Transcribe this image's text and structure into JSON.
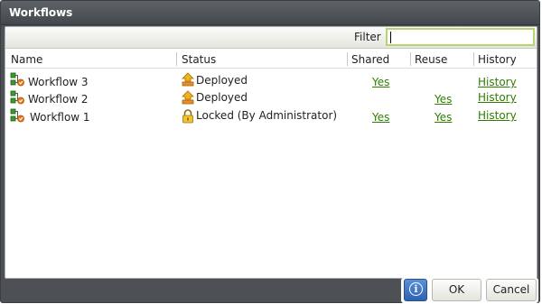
{
  "window": {
    "title": "Workflows"
  },
  "filter": {
    "label": "Filter",
    "value": "",
    "placeholder": ""
  },
  "columns": {
    "name": "Name",
    "status": "Status",
    "shared": "Shared",
    "reuse": "Reuse",
    "history": "History"
  },
  "rows": [
    {
      "name": "Workflow 3",
      "status": "Deployed",
      "status_icon": "deployed-icon",
      "shared": "Yes",
      "reuse": "",
      "history": "History"
    },
    {
      "name": "Workflow  2",
      "status": "Deployed",
      "status_icon": "deployed-icon",
      "shared": "",
      "reuse": "Yes",
      "history": "History"
    },
    {
      "name": "Workflow 1",
      "status": "Locked (By Administrator)",
      "status_icon": "lock-icon",
      "shared": "Yes",
      "reuse": "Yes",
      "history": "History"
    }
  ],
  "buttons": {
    "info": "i",
    "ok": "OK",
    "cancel": "Cancel"
  },
  "colors": {
    "titlebar": "#4d5156",
    "link": "#2f7d00",
    "filter_border": "#b8d46c",
    "info_button": "#2e62b2"
  }
}
